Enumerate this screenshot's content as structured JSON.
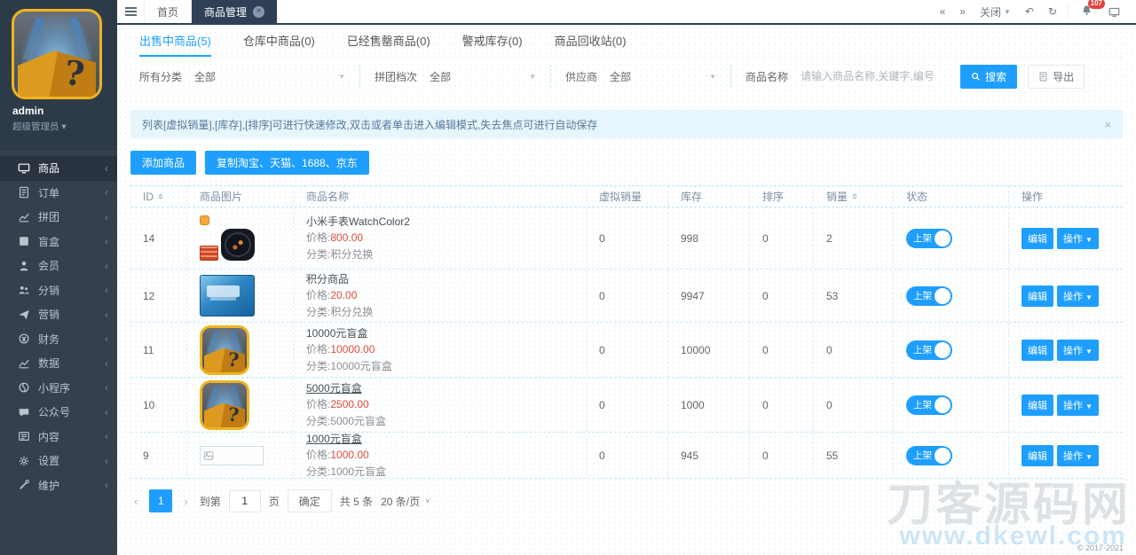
{
  "user": {
    "name": "admin",
    "role": "超级管理员"
  },
  "sidebar": {
    "items": [
      {
        "label": "商品",
        "icon": "goods-icon",
        "active": true
      },
      {
        "label": "订单",
        "icon": "orders-icon"
      },
      {
        "label": "拼团",
        "icon": "groupbuy-icon"
      },
      {
        "label": "盲盒",
        "icon": "blindbox-icon"
      },
      {
        "label": "会员",
        "icon": "member-icon"
      },
      {
        "label": "分销",
        "icon": "distribution-icon"
      },
      {
        "label": "营销",
        "icon": "marketing-icon"
      },
      {
        "label": "财务",
        "icon": "finance-icon"
      },
      {
        "label": "数据",
        "icon": "data-icon"
      },
      {
        "label": "小程序",
        "icon": "miniapp-icon"
      },
      {
        "label": "公众号",
        "icon": "wechat-icon"
      },
      {
        "label": "内容",
        "icon": "content-icon"
      },
      {
        "label": "设置",
        "icon": "settings-icon"
      },
      {
        "label": "维护",
        "icon": "maintain-icon"
      }
    ]
  },
  "topbar": {
    "home_tab": "首页",
    "active_tab": "商品管理",
    "close_menu": "关闭",
    "notice_count": "107"
  },
  "page_tabs": [
    {
      "label": "出售中商品(5)",
      "active": true
    },
    {
      "label": "仓库中商品(0)"
    },
    {
      "label": "已经售罄商品(0)"
    },
    {
      "label": "警戒库存(0)"
    },
    {
      "label": "商品回收站(0)"
    }
  ],
  "filters": {
    "category_label": "所有分类",
    "category_value": "全部",
    "group_label": "拼团档次",
    "group_value": "全部",
    "supplier_label": "供应商",
    "supplier_value": "全部",
    "name_label": "商品名称",
    "name_placeholder": "请输入商品名称,关键字,编号",
    "search_label": "搜索",
    "export_label": "导出"
  },
  "notice": {
    "text": "列表[虚拟销量],[库存],[排序]可进行快速修改,双击或者单击进入编辑模式,失去焦点可进行自动保存",
    "close": "×"
  },
  "actions": {
    "add": "添加商品",
    "copy": "复制淘宝、天猫、1688、京东"
  },
  "table": {
    "headers": {
      "id": "ID",
      "image": "商品图片",
      "name": "商品名称",
      "virtual_sales": "虚拟销量",
      "stock": "库存",
      "sort": "排序",
      "sales": "销量",
      "status": "状态",
      "op": "操作"
    },
    "rows": [
      {
        "id": "14",
        "name": "小米手表WatchColor2",
        "price_label": "价格:",
        "price": "800.00",
        "category": "分类:积分兑换",
        "virtual_sales": "0",
        "stock": "998",
        "sort": "0",
        "sales": "2",
        "status": "上架",
        "edit": "编辑",
        "more": "操作"
      },
      {
        "id": "12",
        "name": "积分商品",
        "price_label": "价格:",
        "price": "20.00",
        "category": "分类:积分兑换",
        "virtual_sales": "0",
        "stock": "9947",
        "sort": "0",
        "sales": "53",
        "status": "上架",
        "edit": "编辑",
        "more": "操作"
      },
      {
        "id": "11",
        "name": "10000元盲盒",
        "price_label": "价格:",
        "price": "10000.00",
        "category": "分类:10000元盲盒",
        "virtual_sales": "0",
        "stock": "10000",
        "sort": "0",
        "sales": "0",
        "status": "上架",
        "edit": "编辑",
        "more": "操作"
      },
      {
        "id": "10",
        "name": "5000元盲盒",
        "price_label": "价格:",
        "price": "2500.00",
        "category": "分类:5000元盲盒",
        "virtual_sales": "0",
        "stock": "1000",
        "sort": "0",
        "sales": "0",
        "status": "上架",
        "edit": "编辑",
        "more": "操作"
      },
      {
        "id": "9",
        "name": "1000元盲盒",
        "price_label": "价格:",
        "price": "1000.00",
        "category": "分类:1000元盲盒",
        "virtual_sales": "0",
        "stock": "945",
        "sort": "0",
        "sales": "55",
        "status": "上架",
        "edit": "编辑",
        "more": "操作"
      }
    ]
  },
  "pagination": {
    "goto_label": "到第",
    "goto_value": "1",
    "page_word": "页",
    "current_page": "1",
    "confirm": "确定",
    "total": "共 5 条",
    "per_page": "20 条/页"
  },
  "watermark": {
    "line1": "刀客源码网",
    "line2": "www.dkewl.com"
  },
  "footer": {
    "copyright": "© 2017-2021"
  },
  "colors": {
    "accent": "#1E9FFF",
    "sidebar": "#36404d",
    "topbar_dark": "#2f4056",
    "price_red": "#e04b3a",
    "notice_bg": "#e7f5fc"
  }
}
